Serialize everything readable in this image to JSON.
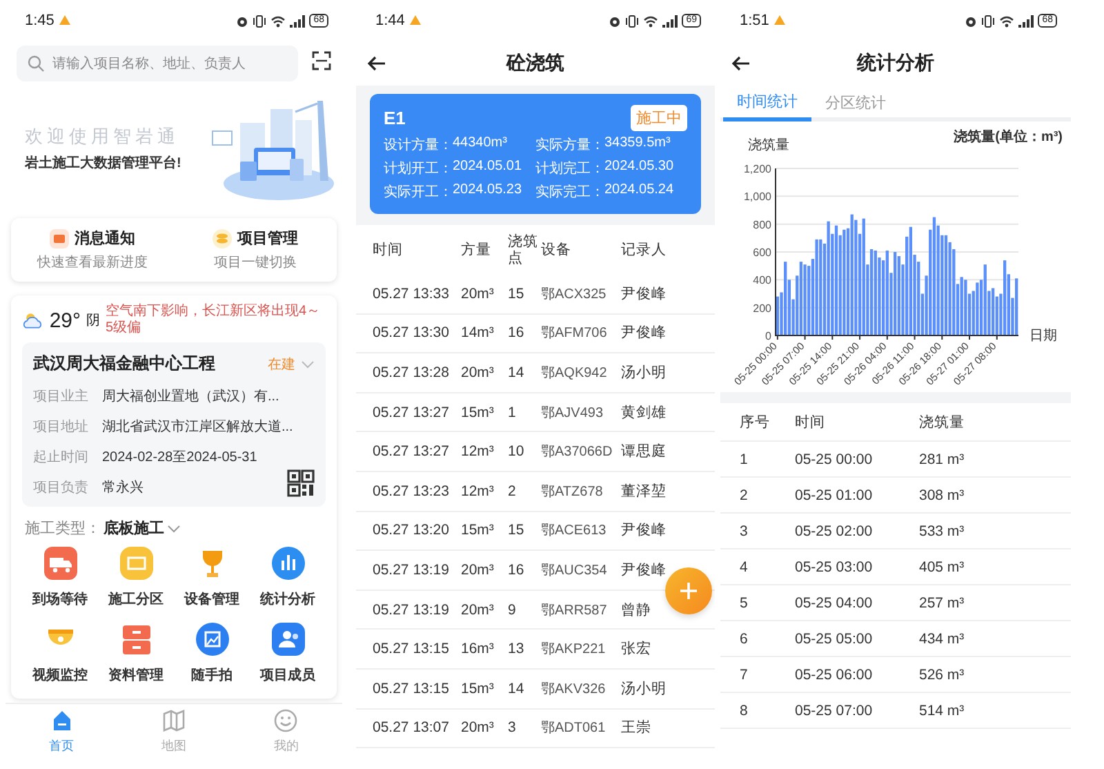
{
  "home": {
    "status_bar": {
      "time": "1:45",
      "battery": "68"
    },
    "search": {
      "placeholder": "请输入项目名称、地址、负责人"
    },
    "banner": {
      "title": "欢迎使用智岩通",
      "subtitle": "岩土施工大数据管理平台!"
    },
    "shortcuts": [
      {
        "title": "消息通知",
        "subtitle": "快速查看最新进度"
      },
      {
        "title": "项目管理",
        "subtitle": "项目一键切换"
      }
    ],
    "weather": {
      "temperature": "29°",
      "condition": "阴",
      "alert": "空气南下影响，长江新区将出现4～5级偏"
    },
    "project": {
      "name": "武汉周大福金融中心工程",
      "status": "在建",
      "fields": [
        {
          "label": "项目业主",
          "value": "周大福创业置地（武汉）有..."
        },
        {
          "label": "项目地址",
          "value": "湖北省武汉市江岸区解放大道..."
        },
        {
          "label": "起止时间",
          "value": "2024-02-28至2024-05-31"
        },
        {
          "label": "项目负责",
          "value": "常永兴"
        }
      ]
    },
    "construction_type": {
      "label": "施工类型：",
      "value": "底板施工"
    },
    "functions": [
      {
        "label": "到场等待"
      },
      {
        "label": "施工分区"
      },
      {
        "label": "设备管理"
      },
      {
        "label": "统计分析"
      },
      {
        "label": "视频监控"
      },
      {
        "label": "资料管理"
      },
      {
        "label": "随手拍"
      },
      {
        "label": "项目成员"
      }
    ],
    "nav": [
      {
        "label": "首页",
        "selected": true
      },
      {
        "label": "地图",
        "selected": false
      },
      {
        "label": "我的",
        "selected": false
      }
    ]
  },
  "pour": {
    "status_bar": {
      "time": "1:44",
      "battery": "69"
    },
    "title": "砼浇筑",
    "summary": {
      "name": "E1",
      "status": "施工中",
      "fields": [
        {
          "label": "设计方量：",
          "value": "44340m³"
        },
        {
          "label": "实际方量：",
          "value": "34359.5m³"
        },
        {
          "label": "计划开工：",
          "value": "2024.05.01"
        },
        {
          "label": "计划完工：",
          "value": "2024.05.30"
        },
        {
          "label": "实际开工：",
          "value": "2024.05.23"
        },
        {
          "label": "实际完工：",
          "value": "2024.05.24"
        }
      ]
    },
    "columns": [
      "时间",
      "方量",
      "浇筑点",
      "设备",
      "记录人"
    ],
    "rows": [
      [
        "05.27 13:33",
        "20m³",
        "15",
        "鄂ACX325",
        "尹俊峰"
      ],
      [
        "05.27 13:30",
        "14m³",
        "16",
        "鄂AFM706",
        "尹俊峰"
      ],
      [
        "05.27 13:28",
        "20m³",
        "14",
        "鄂AQK942",
        "汤小明"
      ],
      [
        "05.27 13:27",
        "15m³",
        "1",
        "鄂AJV493",
        "黄剑雄"
      ],
      [
        "05.27 13:27",
        "12m³",
        "10",
        "鄂A37066D",
        "谭思庭"
      ],
      [
        "05.27 13:23",
        "12m³",
        "2",
        "鄂ATZ678",
        "董泽堃"
      ],
      [
        "05.27 13:20",
        "15m³",
        "15",
        "鄂ACE613",
        "尹俊峰"
      ],
      [
        "05.27 13:19",
        "20m³",
        "16",
        "鄂AUC354",
        "尹俊峰"
      ],
      [
        "05.27 13:19",
        "20m³",
        "9",
        "鄂ARR587",
        "曾静"
      ],
      [
        "05.27 13:15",
        "16m³",
        "13",
        "鄂AKP221",
        "张宏"
      ],
      [
        "05.27 13:15",
        "15m³",
        "14",
        "鄂AKV326",
        "汤小明"
      ],
      [
        "05.27 13:07",
        "20m³",
        "3",
        "鄂ADT061",
        "王崇"
      ]
    ]
  },
  "stats": {
    "status_bar": {
      "time": "1:51",
      "battery": "68"
    },
    "title": "统计分析",
    "tabs": [
      {
        "label": "时间统计",
        "selected": true
      },
      {
        "label": "分区统计",
        "selected": false
      }
    ],
    "chart_data": {
      "type": "bar",
      "title": "浇筑量(单位：m³)",
      "ylabel": "浇筑量",
      "xlabel": "日期",
      "categories": [
        "05-25 00:00",
        null,
        null,
        null,
        null,
        null,
        null,
        "05-25 07:00",
        null,
        null,
        null,
        null,
        null,
        null,
        "05-25 14:00",
        null,
        null,
        null,
        null,
        null,
        null,
        "05-25 21:00",
        null,
        null,
        null,
        null,
        null,
        null,
        "05-26 04:00",
        null,
        null,
        null,
        null,
        null,
        null,
        "05-26 11:00",
        null,
        null,
        null,
        null,
        null,
        null,
        "05-26 18:00",
        null,
        null,
        null,
        null,
        null,
        null,
        "05-27 01:00",
        null,
        null,
        null,
        null,
        null,
        null,
        "05-27 08:00",
        null,
        null,
        null,
        null,
        null
      ],
      "series": [
        {
          "color": "#5b8ff9",
          "values": [
            280,
            310,
            530,
            400,
            260,
            430,
            530,
            510,
            500,
            550,
            690,
            690,
            660,
            820,
            730,
            790,
            720,
            760,
            770,
            870,
            830,
            730,
            840,
            510,
            620,
            610,
            560,
            540,
            610,
            450,
            600,
            570,
            510,
            710,
            780,
            580,
            530,
            300,
            430,
            760,
            850,
            790,
            720,
            720,
            670,
            620,
            370,
            420,
            400,
            300,
            320,
            380,
            400,
            510,
            320,
            340,
            280,
            300,
            540,
            440,
            270,
            410
          ]
        }
      ],
      "ylim": [
        0,
        1200
      ],
      "grid": true,
      "yticks": [
        0,
        200,
        400,
        600,
        800,
        {
          "value": 1000,
          "label": "1,000"
        },
        {
          "value": 1200,
          "label": "1,200"
        }
      ]
    },
    "columns": [
      "序号",
      "时间",
      "浇筑量"
    ],
    "rows": [
      [
        "1",
        "05-25 00:00",
        "281 m³"
      ],
      [
        "2",
        "05-25 01:00",
        "308 m³"
      ],
      [
        "3",
        "05-25 02:00",
        "533 m³"
      ],
      [
        "4",
        "05-25 03:00",
        "405 m³"
      ],
      [
        "5",
        "05-25 04:00",
        "257 m³"
      ],
      [
        "6",
        "05-25 05:00",
        "434 m³"
      ],
      [
        "7",
        "05-25 06:00",
        "526 m³"
      ],
      [
        "8",
        "05-25 07:00",
        "514 m³"
      ]
    ]
  }
}
